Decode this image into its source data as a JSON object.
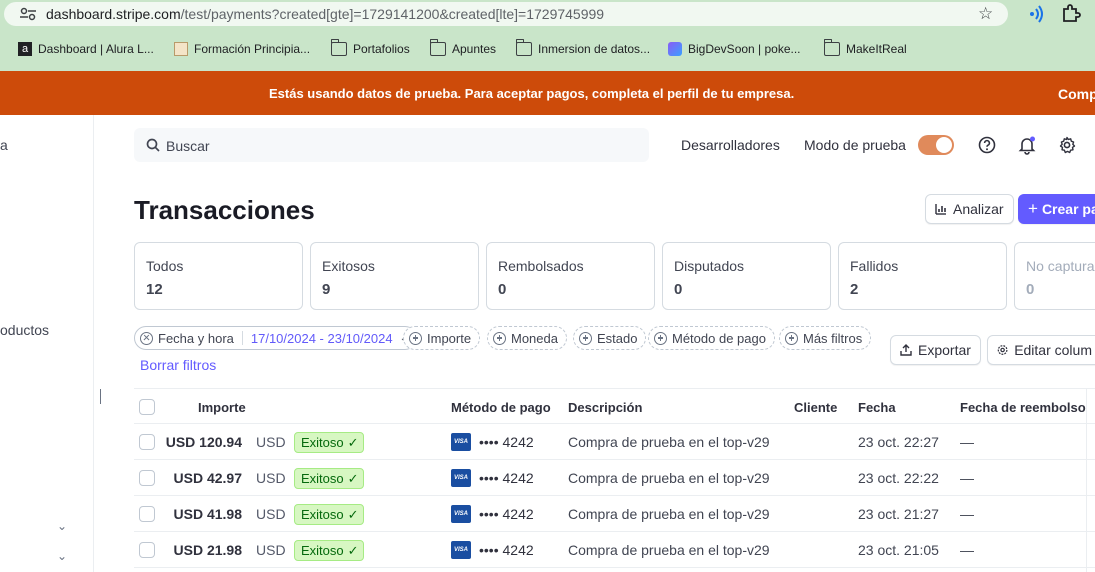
{
  "browser": {
    "url_main": "dashboard.stripe.com",
    "url_rest": "/test/payments?created[gte]=1729141200&created[lte]=1729745999",
    "bookmarks": [
      {
        "label": "Dashboard | Alura L...",
        "icon": "alura-icon"
      },
      {
        "label": "Formación Principia...",
        "icon": "principia-icon"
      },
      {
        "label": "Portafolios",
        "icon": "folder-icon"
      },
      {
        "label": "Apuntes",
        "icon": "folder-icon"
      },
      {
        "label": "Inmersion de datos...",
        "icon": "folder-icon"
      },
      {
        "label": "BigDevSoon | poke...",
        "icon": "bigdevsoon-icon"
      },
      {
        "label": "MakeItReal",
        "icon": "folder-icon"
      }
    ]
  },
  "banner": {
    "message": "Estás usando datos de prueba. Para aceptar pagos, completa el perfil de tu empresa.",
    "cta": "Comp"
  },
  "sidebar": {
    "item1": "a",
    "item2": "oductos"
  },
  "topbar": {
    "search_placeholder": "Buscar",
    "developers": "Desarrolladores",
    "test_mode": "Modo de prueba"
  },
  "page": {
    "title": "Transacciones",
    "analyze_label": "Analizar",
    "create_label": "Crear pa"
  },
  "tabs": [
    {
      "label": "Todos",
      "count": "12"
    },
    {
      "label": "Exitosos",
      "count": "9"
    },
    {
      "label": "Rembolsados",
      "count": "0"
    },
    {
      "label": "Disputados",
      "count": "0"
    },
    {
      "label": "Fallidos",
      "count": "2"
    },
    {
      "label": "No captura",
      "count": "0"
    }
  ],
  "filters": {
    "date_label": "Fecha y hora",
    "date_value": "17/10/2024 - 23/10/2024",
    "chips": [
      "Importe",
      "Moneda",
      "Estado",
      "Método de pago",
      "Más filtros"
    ],
    "clear": "Borrar filtros",
    "export": "Exportar",
    "edit_columns": "Editar colum"
  },
  "table": {
    "headers": {
      "amount": "Importe",
      "method": "Método de pago",
      "description": "Descripción",
      "customer": "Cliente",
      "date": "Fecha",
      "refund_date": "Fecha de reembolso"
    },
    "rows": [
      {
        "amount": "USD 120.94",
        "currency": "USD",
        "status": "Exitoso",
        "card_brand": "VISA",
        "card": "•••• 4242",
        "description": "Compra de prueba en el top-v29",
        "date": "23 oct. 22:27",
        "refund": "—"
      },
      {
        "amount": "USD 42.97",
        "currency": "USD",
        "status": "Exitoso",
        "card_brand": "VISA",
        "card": "•••• 4242",
        "description": "Compra de prueba en el top-v29",
        "date": "23 oct. 22:22",
        "refund": "—"
      },
      {
        "amount": "USD 41.98",
        "currency": "USD",
        "status": "Exitoso",
        "card_brand": "VISA",
        "card": "•••• 4242",
        "description": "Compra de prueba en el top-v29",
        "date": "23 oct. 21:27",
        "refund": "—"
      },
      {
        "amount": "USD 21.98",
        "currency": "USD",
        "status": "Exitoso",
        "card_brand": "VISA",
        "card": "•••• 4242",
        "description": "Compra de prueba en el top-v29",
        "date": "23 oct. 21:05",
        "refund": "—"
      }
    ]
  },
  "colors": {
    "banner": "#cd4b0a",
    "accent": "#635bff",
    "success_bg": "#d7f7c2",
    "success_text": "#05690d",
    "toggle": "#e08a5b"
  }
}
